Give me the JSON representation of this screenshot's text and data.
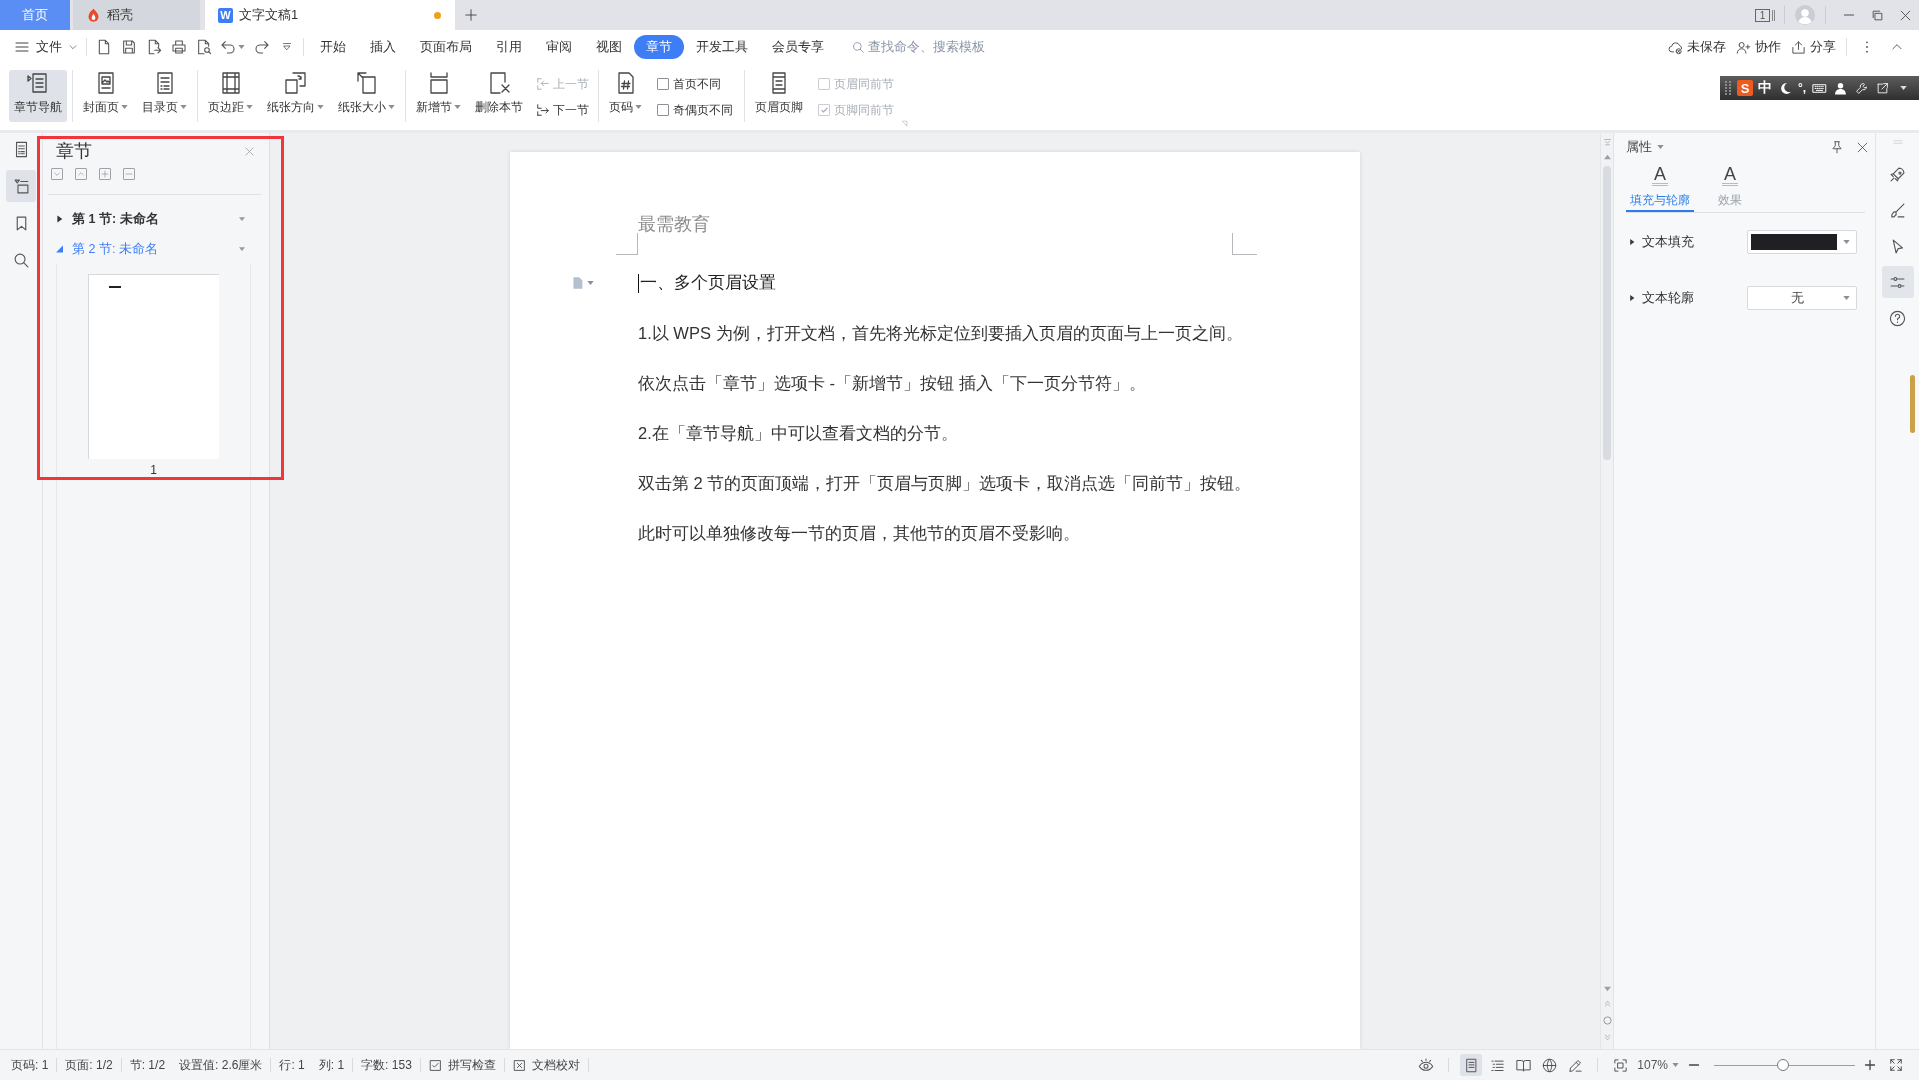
{
  "title_bar": {
    "tabs": [
      {
        "kind": "home",
        "label": "首页",
        "selected": false,
        "modified": false
      },
      {
        "kind": "docer",
        "label": "稻壳",
        "selected": false,
        "modified": false
      },
      {
        "kind": "document",
        "logo": "W",
        "label": "文字文稿1",
        "selected": true,
        "modified": true
      }
    ],
    "window_count": "1"
  },
  "menu_bar": {
    "file_menu": "文件",
    "tabs": [
      {
        "label": "开始",
        "selected": false
      },
      {
        "label": "插入",
        "selected": false
      },
      {
        "label": "页面布局",
        "selected": false
      },
      {
        "label": "引用",
        "selected": false
      },
      {
        "label": "审阅",
        "selected": false
      },
      {
        "label": "视图",
        "selected": false
      },
      {
        "label": "章节",
        "selected": true
      },
      {
        "label": "开发工具",
        "selected": false
      },
      {
        "label": "会员专享",
        "selected": false
      }
    ],
    "search": {
      "placeholder": "查找命令、搜索模板"
    },
    "actions": [
      {
        "label": "未保存"
      },
      {
        "label": "协作"
      },
      {
        "label": "分享"
      }
    ]
  },
  "ime_toolbar": {
    "logo": "S",
    "mode": "中",
    "punctuation": "°,"
  },
  "ribbon": {
    "groups": [
      {
        "items": [
          {
            "kind": "large",
            "label": "章节导航",
            "on": true,
            "dropdown": false
          }
        ]
      },
      {
        "items": [
          {
            "kind": "large",
            "label": "封面页",
            "on": false,
            "dropdown": true
          },
          {
            "kind": "large",
            "label": "目录页",
            "on": false,
            "dropdown": true
          }
        ]
      },
      {
        "items": [
          {
            "kind": "large",
            "label": "页边距",
            "on": false,
            "dropdown": true
          },
          {
            "kind": "large",
            "label": "纸张方向",
            "on": false,
            "dropdown": true
          },
          {
            "kind": "large",
            "label": "纸张大小",
            "on": false,
            "dropdown": true
          }
        ]
      },
      {
        "items": [
          {
            "kind": "large",
            "label": "新增节",
            "on": false,
            "dropdown": true
          },
          {
            "kind": "large",
            "label": "删除本节",
            "on": false,
            "dropdown": false
          },
          {
            "kind": "stack",
            "buttons": [
              {
                "label": "上一节",
                "disabled": true
              },
              {
                "label": "下一节",
                "disabled": false
              }
            ]
          }
        ]
      },
      {
        "items": [
          {
            "kind": "large",
            "label": "页码",
            "on": false,
            "dropdown": true
          },
          {
            "kind": "checks",
            "boxes": [
              {
                "label": "首页不同",
                "checked": false,
                "disabled": false
              },
              {
                "label": "奇偶页不同",
                "checked": false,
                "disabled": false
              }
            ]
          }
        ]
      },
      {
        "items": [
          {
            "kind": "large",
            "label": "页眉页脚",
            "on": false,
            "dropdown": false
          },
          {
            "kind": "checks",
            "boxes": [
              {
                "label": "页眉同前节",
                "checked": false,
                "disabled": true
              },
              {
                "label": "页脚同前节",
                "checked": true,
                "disabled": true
              }
            ]
          }
        ]
      }
    ]
  },
  "nav_strip": [
    {
      "selected": false
    },
    {
      "selected": true
    },
    {
      "selected": false
    },
    {
      "selected": false
    }
  ],
  "chapter_panel": {
    "title": "章节",
    "highlighted": true,
    "sections": [
      {
        "label": "第 1 节: 未命名",
        "current": true,
        "selected": false,
        "expanded": false
      },
      {
        "label": "第 2 节: 未命名",
        "current": false,
        "selected": true,
        "expanded": true,
        "pages": [
          {
            "number": "1"
          }
        ]
      }
    ]
  },
  "document": {
    "header": "最需教育",
    "paragraphs": [
      {
        "kind": "heading",
        "text": "一、多个页眉设置",
        "caret": true
      },
      {
        "kind": "body",
        "text": "1.以 WPS 为例，打开文档，首先将光标定位到要插入页眉的页面与上一页之间。",
        "caret": false
      },
      {
        "kind": "body",
        "text": "依次点击「章节」选项卡 -「新增节」按钮 插入「下一页分节符」。",
        "caret": false
      },
      {
        "kind": "body",
        "text": "2.在「章节导航」中可以查看文档的分节。",
        "caret": false
      },
      {
        "kind": "body",
        "text": "双击第 2 节的页面顶端，打开「页眉与页脚」选项卡，取消点选「同前节」按钮。",
        "caret": false
      },
      {
        "kind": "body",
        "text": "此时可以单独修改每一节的页眉，其他节的页眉不受影响。",
        "caret": false
      }
    ]
  },
  "properties_panel": {
    "title": "属性",
    "tabs": [
      {
        "glyph": "A",
        "label": "填充与轮廓",
        "selected": true
      },
      {
        "glyph": "A",
        "label": "效果",
        "selected": false
      }
    ],
    "rows": [
      {
        "kind": "color",
        "label": "文本填充",
        "color": "#202024"
      },
      {
        "kind": "select",
        "label": "文本轮廓",
        "value": "无"
      }
    ]
  },
  "side_strip": [
    {
      "selected": false
    },
    {
      "selected": false
    },
    {
      "selected": false
    },
    {
      "selected": true
    },
    {
      "selected": false
    }
  ],
  "status_bar": {
    "groups": [
      [
        "页码: 1"
      ],
      [
        "页面: 1/2"
      ],
      [
        "节: 1/2",
        "设置值: 2.6厘米"
      ],
      [
        "行: 1",
        "列: 1"
      ],
      [
        "字数: 153"
      ]
    ],
    "tools": [
      {
        "label": "拼写检查"
      },
      {
        "label": "文档校对"
      }
    ],
    "view_modes": [
      {
        "selected": true
      },
      {
        "selected": false
      },
      {
        "selected": false
      },
      {
        "selected": false
      }
    ],
    "zoom": {
      "label": "107%",
      "level": 0.49
    }
  }
}
